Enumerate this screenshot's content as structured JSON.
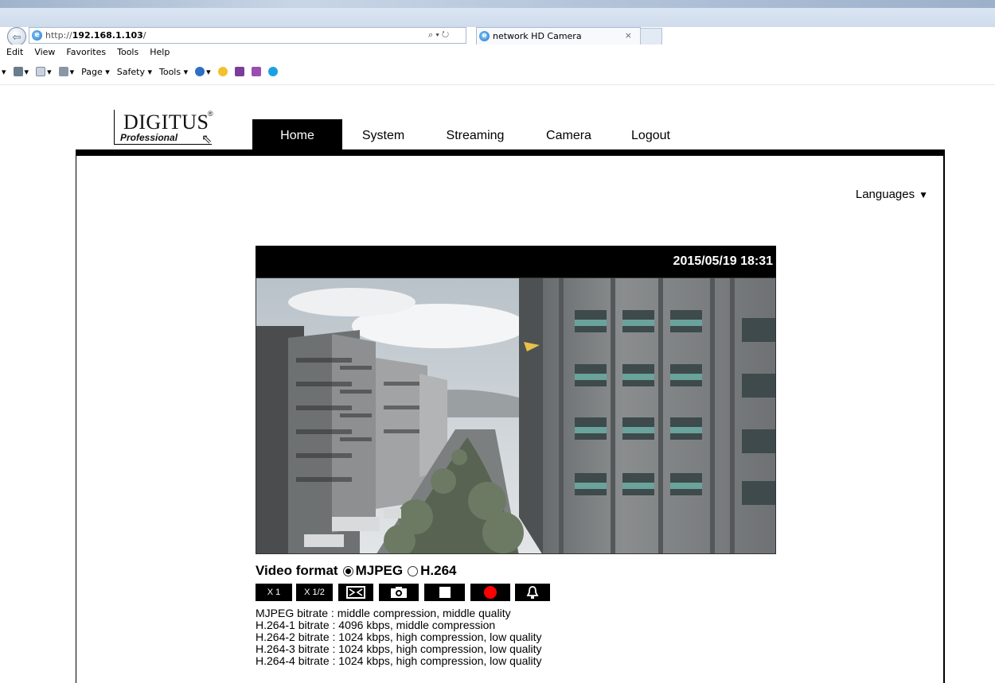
{
  "browser": {
    "url_protocol": "http://",
    "url_host": "192.168.1.103",
    "url_path": "/",
    "tab_title": "network HD Camera",
    "tab_close": "×",
    "search_glyph": "⌕ ▾ ↻",
    "menu": [
      "Edit",
      "View",
      "Favorites",
      "Tools",
      "Help"
    ],
    "commands": [
      {
        "label": "▾",
        "icon": "feeds-icon"
      },
      {
        "label": "▾",
        "icon": "mail-icon"
      },
      {
        "label": "▾",
        "icon": "print-icon"
      },
      {
        "label": "Page ▾",
        "icon": ""
      },
      {
        "label": "Safety ▾",
        "icon": ""
      },
      {
        "label": "Tools ▾",
        "icon": ""
      },
      {
        "label": "▾",
        "icon": "help-icon"
      }
    ]
  },
  "brand": {
    "logo_main": "DIGITUS",
    "logo_reg": "®",
    "logo_sub": "Professional"
  },
  "nav": {
    "tabs": [
      "Home",
      "System",
      "Streaming",
      "Camera",
      "Logout"
    ],
    "active": "Home"
  },
  "languages": {
    "label": "Languages",
    "arrow": "▼"
  },
  "video": {
    "timestamp": "2015/05/19 18:31"
  },
  "format": {
    "label": "Video format",
    "options": [
      "MJPEG",
      "H.264"
    ],
    "selected": "MJPEG"
  },
  "controls": {
    "zoom_x1": "X 1",
    "zoom_half": "X 1/2",
    "fullscreen_icon": "fullscreen-icon",
    "snapshot_icon": "camera-icon",
    "stop_icon": "stop-icon",
    "record_icon": "record-icon",
    "alarm_icon": "bell-icon",
    "record_color": "#ff0000"
  },
  "bitrates": [
    {
      "label": "MJPEG bitrate",
      "value": "middle compression, middle quality"
    },
    {
      "label": "H.264-1 bitrate",
      "value": "4096 kbps, middle compression"
    },
    {
      "label": "H.264-2 bitrate",
      "value": "1024 kbps, high compression, low quality"
    },
    {
      "label": "H.264-3 bitrate",
      "value": "1024 kbps, high compression, low quality"
    },
    {
      "label": "H.264-4 bitrate",
      "value": "1024 kbps, high compression, low quality"
    }
  ]
}
